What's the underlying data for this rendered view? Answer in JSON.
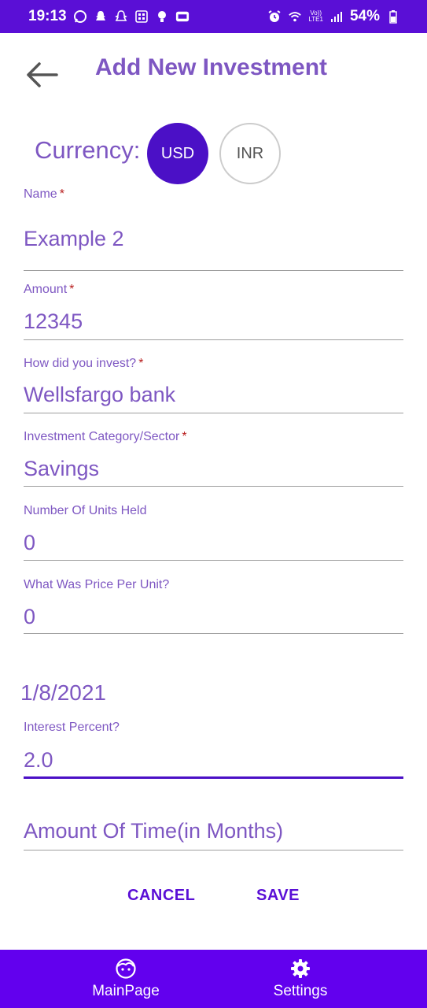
{
  "status_bar": {
    "time": "19:13",
    "left_icons": [
      "whatsapp-icon",
      "snapchat-icon",
      "snapchat-icon",
      "app-grid-icon",
      "lightbulb-icon",
      "app-icon"
    ],
    "right_icons": [
      "alarm-icon",
      "wifi-icon",
      "volte-icon",
      "signal-icon"
    ],
    "lte_top": "Vo))",
    "lte_bottom": "LTE1",
    "battery": "54%"
  },
  "header": {
    "title": "Add New Investment"
  },
  "currency": {
    "label": "Currency:",
    "options": [
      "USD",
      "INR"
    ],
    "selected": "USD"
  },
  "fields": {
    "name": {
      "label": "Name",
      "required": "*",
      "value": "Example 2"
    },
    "amount": {
      "label": "Amount",
      "required": "*",
      "value": "12345"
    },
    "how_invested": {
      "label": "How did you invest?",
      "required": "*",
      "value": "Wellsfargo bank"
    },
    "category": {
      "label": "Investment Category/Sector",
      "required": "*",
      "value": "Savings"
    },
    "units": {
      "label": "Number Of Units Held",
      "value": "0"
    },
    "price": {
      "label": "What Was Price Per Unit?",
      "value": "0"
    },
    "date": "1/8/2021",
    "interest": {
      "label": "Interest Percent?",
      "value": "2.0"
    },
    "time": {
      "placeholder": "Amount Of Time(in Months)"
    }
  },
  "actions": {
    "cancel": "CANCEL",
    "save": "SAVE"
  },
  "bottom_nav": {
    "items": [
      {
        "label": "MainPage",
        "icon": "face-icon"
      },
      {
        "label": "Settings",
        "icon": "gear-icon"
      }
    ]
  },
  "colors": {
    "primary": "#6200ee",
    "dark_primary": "#4b10c6",
    "accent_text": "#7e57c2",
    "required": "#b71c1c"
  }
}
